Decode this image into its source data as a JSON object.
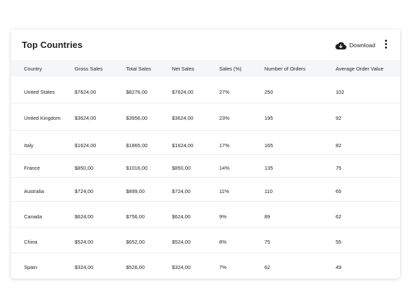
{
  "card": {
    "title": "Top Countries",
    "download_label": "Download"
  },
  "table": {
    "columns": [
      "Country",
      "Gross Sales",
      "Total Sales",
      "Net Sales",
      "Sales (%)",
      "Number of Orders",
      "Average Order Value"
    ],
    "rows": [
      [
        "United States",
        "$7624,00",
        "$8276,00",
        "$7624,00",
        "27%",
        "250",
        "102"
      ],
      [
        "United Kingdom",
        "$3624,00",
        "$3956,00",
        "$3624,00",
        "23%",
        "195",
        "92"
      ],
      [
        "Italy",
        "$1624,00",
        "$1865,00",
        "$1624,00",
        "17%",
        "165",
        "82"
      ],
      [
        "France",
        "$850,00",
        "$1016,00",
        "$850,00",
        "14%",
        "135",
        "75"
      ],
      [
        "Australia",
        "$724,00",
        "$899,00",
        "$724,00",
        "11%",
        "110",
        "65"
      ],
      [
        "Canada",
        "$624,00",
        "$756,00",
        "$624,00",
        "9%",
        "89",
        "62"
      ],
      [
        "China",
        "$524,00",
        "$652,00",
        "$524,00",
        "8%",
        "75",
        "55"
      ],
      [
        "Spain",
        "$324,00",
        "$526,00",
        "$324,00",
        "7%",
        "62",
        "49"
      ]
    ]
  },
  "icons": {
    "download": "cloud-download-icon",
    "menu": "more-vertical-icon"
  },
  "colors": {
    "header_bg": "#f5f6f8",
    "row_divider": "#eceef1",
    "text": "#222222"
  }
}
